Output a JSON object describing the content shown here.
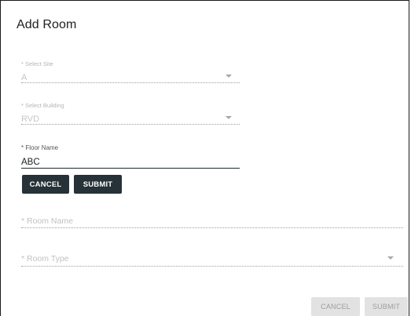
{
  "dialog": {
    "title": "Add Room"
  },
  "form": {
    "site": {
      "label": "* Select Site",
      "value": "A"
    },
    "building": {
      "label": "* Select Building",
      "value": "RVD"
    },
    "floor": {
      "label": "* Floor Name",
      "value": "ABC"
    },
    "floor_actions": {
      "cancel_label": "CANCEL",
      "submit_label": "SUBMIT"
    },
    "room_name": {
      "placeholder": "* Room Name"
    },
    "room_type": {
      "placeholder": "* Room Type"
    }
  },
  "footer": {
    "cancel_label": "CANCEL",
    "submit_label": "SUBMIT"
  },
  "icons": {
    "dropdown": "chevron-down-icon"
  },
  "colors": {
    "primary_button": "#263238",
    "disabled_button": "#e2e2e2",
    "active_underline": "#1f2a30"
  }
}
